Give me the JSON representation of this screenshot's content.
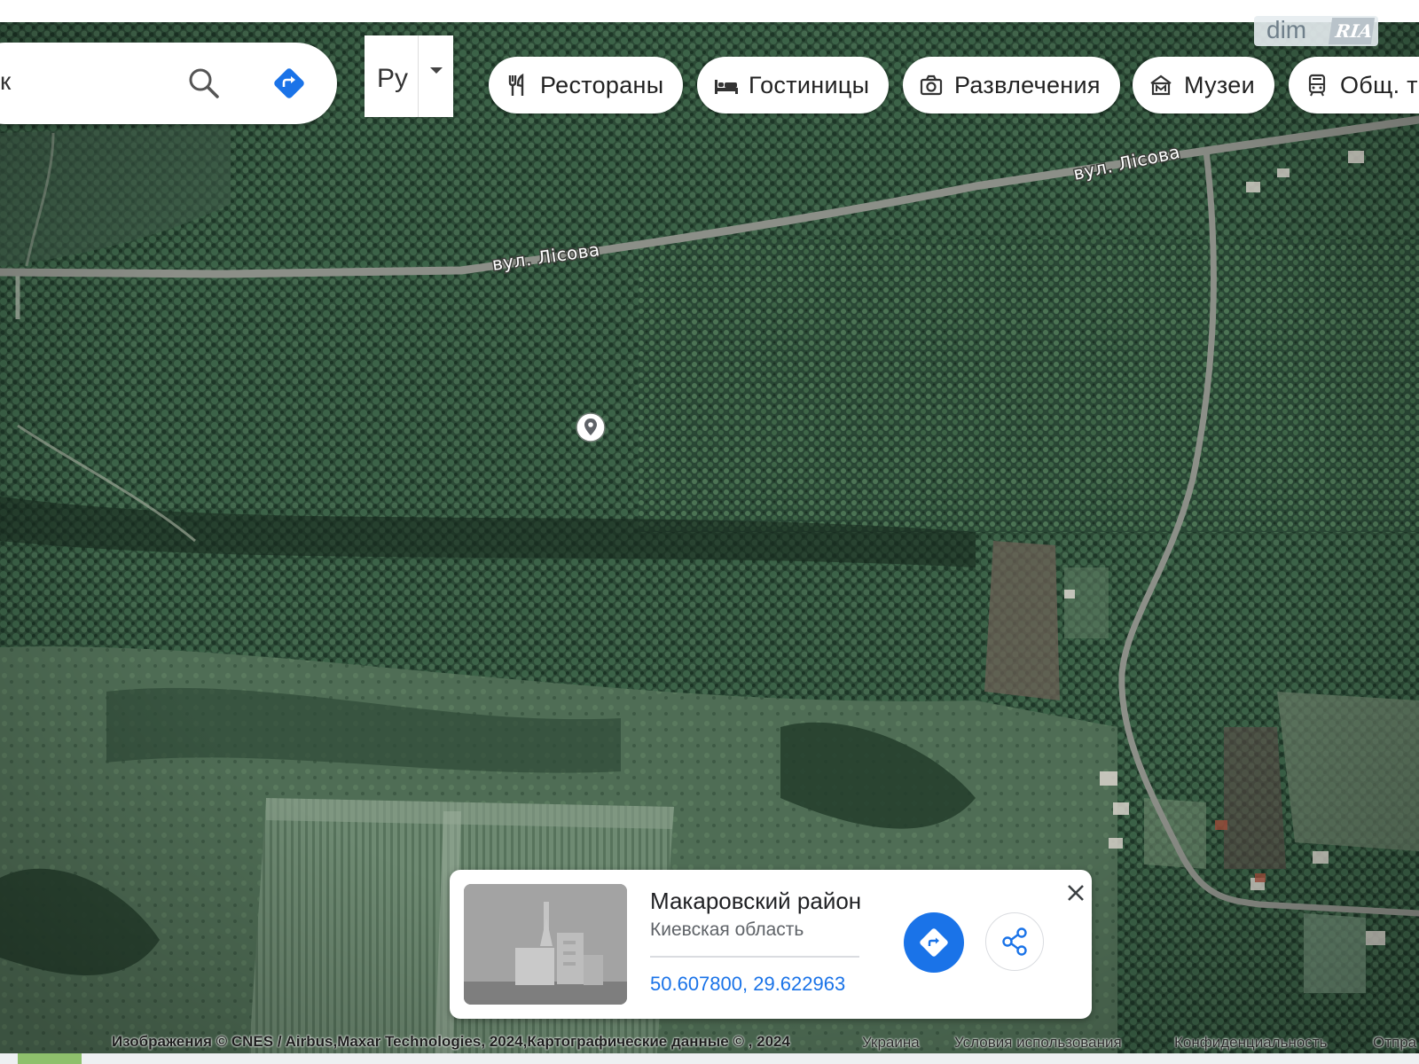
{
  "search": {
    "query_fragment": "к",
    "search_icon": "search-icon",
    "directions_icon": "directions-diamond-icon"
  },
  "language": {
    "label": "Ру",
    "icon": "chevron-down-icon"
  },
  "categories": [
    {
      "label": "Рестораны",
      "icon": "fork-knife-icon"
    },
    {
      "label": "Гостиницы",
      "icon": "bed-icon"
    },
    {
      "label": "Развлечения",
      "icon": "camera-icon"
    },
    {
      "label": "Музеи",
      "icon": "museum-icon"
    },
    {
      "label": "Общ. тр",
      "icon": "transit-icon"
    }
  ],
  "watermark": {
    "text1": "dim",
    "text2": "RIA"
  },
  "map": {
    "roads": [
      "вул. Лісова",
      "вул. Лісова"
    ],
    "layer": "satellite"
  },
  "place_card": {
    "title": "Макаровский район",
    "subtitle": "Киевская область",
    "coordinates": "50.607800, 29.622963",
    "directions_icon": "directions-diamond-icon",
    "share_icon": "share-icon",
    "close_icon": "close-icon"
  },
  "attribution": {
    "imagery": "Изображения © CNES / Airbus,Maxar Technologies, 2024,Картографические данные © , 2024",
    "country": "Украина",
    "terms": "Условия использования",
    "privacy": "Конфиденциальность",
    "feedback": "Отпра"
  },
  "colors": {
    "accent_blue": "#1a73e8",
    "forest_dark": "#1f3a2c",
    "road_gray": "#8c8f88"
  }
}
